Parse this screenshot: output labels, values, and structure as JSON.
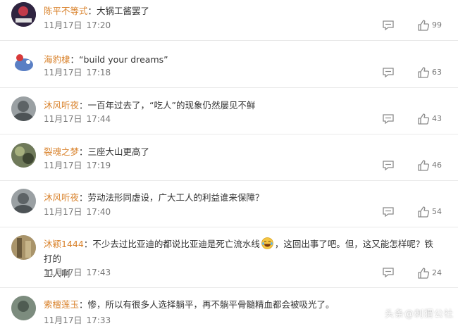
{
  "comments": [
    {
      "user": "陈平不等式",
      "text": "大锅工酱罢了",
      "date": "11月17日",
      "time": "17:20",
      "likes": "99"
    },
    {
      "user": "海豹棣",
      "text": "“build your dreams”",
      "date": "11月17日",
      "time": "17:18",
      "likes": "63"
    },
    {
      "user": "沐风听夜",
      "text": "一百年过去了，“吃人”的现象仍然屡见不鲜",
      "date": "11月17日",
      "time": "17:44",
      "likes": "43"
    },
    {
      "user": "裂魂之梦",
      "text": "三座大山更高了",
      "date": "11月17日",
      "time": "17:19",
      "likes": "46"
    },
    {
      "user": "沐风听夜",
      "text": "劳动法形同虚设，广大工人的利益谁来保障？",
      "date": "11月17日",
      "time": "17:40",
      "likes": "54"
    },
    {
      "user": "沐颖1444",
      "text_before": "不少去过比亚迪的都说比亚迪是死亡流水线",
      "emoji": "laughing-crying-emoji",
      "text_after": "，这回出事了吧。但，这又能怎样呢？铁打的",
      "text_line2": "工人啊",
      "date": "11月17日",
      "time": "17:43",
      "likes": "24"
    },
    {
      "user": "索檀莲玉",
      "text": "惨，所以有很多人选择躺平，再不躺平骨髓精血都会被吸光了。",
      "date": "11月17日",
      "time": "17:33",
      "likes": ""
    }
  ],
  "colon": "：",
  "watermark": "头条@刺猬公社",
  "colors": {
    "username": "#d9822b",
    "text": "#333333",
    "meta": "#777777",
    "icon": "#8a8a8a"
  },
  "icons": {
    "reply": "comment-icon",
    "like": "thumbs-up-icon"
  }
}
